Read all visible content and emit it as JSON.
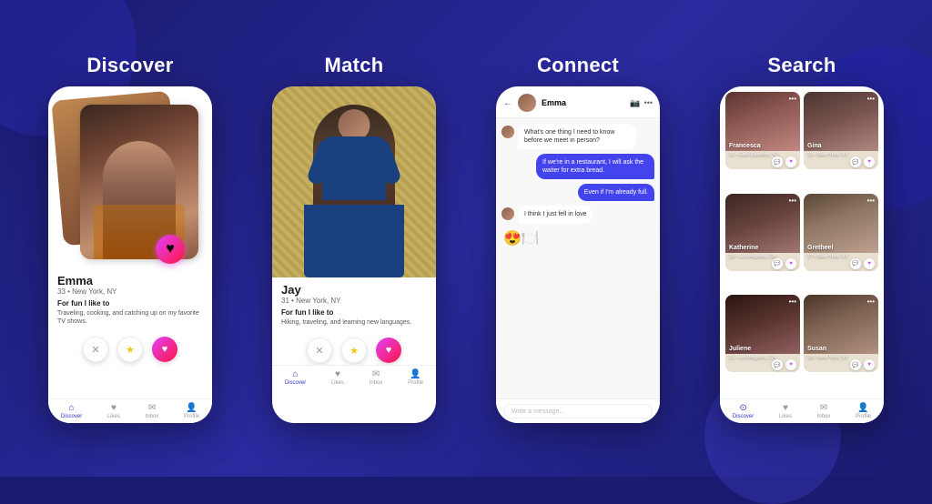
{
  "sections": [
    {
      "id": "discover",
      "title": "Discover",
      "person": {
        "name": "Emma",
        "age": "33",
        "location": "New York, NY",
        "bio_title": "For fun I like to",
        "bio": "Traveling, cooking, and catching up on my favorite TV shows."
      }
    },
    {
      "id": "match",
      "title": "Match",
      "person": {
        "name": "Jay",
        "age": "31",
        "location": "New York, NY",
        "bio_title": "For fun I like to",
        "bio": "Hiking, traveling, and learning new languages."
      }
    },
    {
      "id": "connect",
      "title": "Connect",
      "chat": {
        "name": "Emma",
        "messages": [
          {
            "type": "their",
            "text": "What's one thing I need to know before we meet in person?"
          },
          {
            "type": "mine",
            "text": "If we're in a restaurant, I will ask the waiter for extra bread."
          },
          {
            "type": "mine",
            "text": "Even if I'm already full."
          },
          {
            "type": "their",
            "text": "I think I just fell in love"
          },
          {
            "type": "emoji",
            "text": "😍🍽️"
          }
        ],
        "input_placeholder": "Write a message..."
      }
    },
    {
      "id": "search",
      "title": "Search",
      "profiles": [
        {
          "name": "Francesca",
          "age": "26",
          "location": "East Camden, NJ",
          "photo_class": "photo-francesca"
        },
        {
          "name": "Gina",
          "age": "29",
          "location": "New York, NY",
          "photo_class": "photo-gina"
        },
        {
          "name": "Katherine",
          "age": "28",
          "location": "Los Angeles, CA",
          "photo_class": "photo-katherine"
        },
        {
          "name": "Gretheel",
          "age": "27",
          "location": "New York, NY",
          "photo_class": "photo-gretheel"
        },
        {
          "name": "Juliene",
          "age": "31",
          "location": "Los Angeles, CA",
          "photo_class": "photo-juliene"
        },
        {
          "name": "Susan",
          "age": "28",
          "location": "New York, NY",
          "photo_class": "photo-susan"
        }
      ]
    }
  ],
  "nav": {
    "items": [
      "Discover",
      "Likes",
      "Inbox",
      "Profile"
    ]
  },
  "icons": {
    "heart": "♥",
    "close": "✕",
    "star": "★",
    "home": "⌂",
    "person": "👤",
    "chat": "💬",
    "search": "⊙",
    "dots": "•••",
    "back": "←",
    "camera": "📷",
    "video": "📹"
  }
}
